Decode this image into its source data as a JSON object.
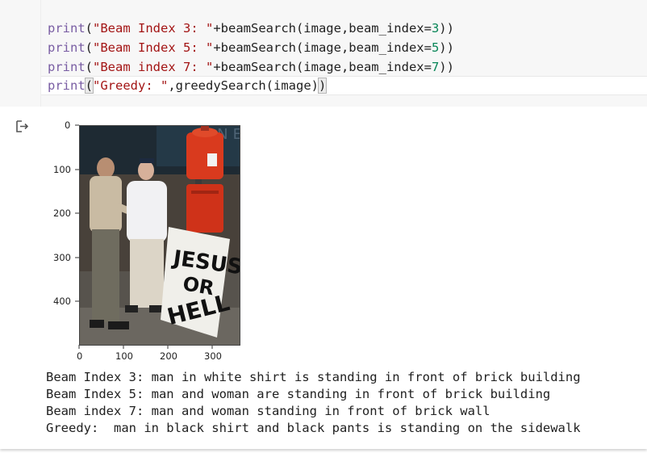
{
  "code": {
    "lines": [
      {
        "fn": "print",
        "open": "(",
        "str": "\"Beam Index 3: \"",
        "rest1": "+beamSearch(image,beam_index=",
        "num": "3",
        "rest2": "))"
      },
      {
        "fn": "print",
        "open": "(",
        "str": "\"Beam Index 5: \"",
        "rest1": "+beamSearch(image,beam_index=",
        "num": "5",
        "rest2": "))"
      },
      {
        "fn": "print",
        "open": "(",
        "str": "\"Beam index 7: \"",
        "rest1": "+beamSearch(image,beam_index=",
        "num": "7",
        "rest2": "))"
      },
      {
        "fn": "print",
        "open": "(",
        "str": "\"Greedy: \"",
        "rest1": ",greedySearch(image)",
        "num": "",
        "rest2": ")"
      }
    ]
  },
  "output": {
    "icon": "output-arrow-icon",
    "y_ticks": [
      "0",
      "100",
      "200",
      "300",
      "400"
    ],
    "x_ticks": [
      "0",
      "100",
      "200",
      "300"
    ],
    "image_text": {
      "sign_line1": "JESUS",
      "sign_line2": "OR",
      "sign_line3": "HELL",
      "banner": "ONE"
    },
    "results": [
      "Beam Index 3: man in white shirt is standing in front of brick building",
      "Beam Index 5: man and woman are standing in front of brick building",
      "Beam index 7: man and woman standing in front of brick wall",
      "Greedy:  man in black shirt and black pants is standing on the sidewalk"
    ]
  },
  "colors": {
    "code_bg": "#f7f7f7",
    "keyword": "#795da3",
    "string": "#a31515",
    "number": "#098658"
  }
}
